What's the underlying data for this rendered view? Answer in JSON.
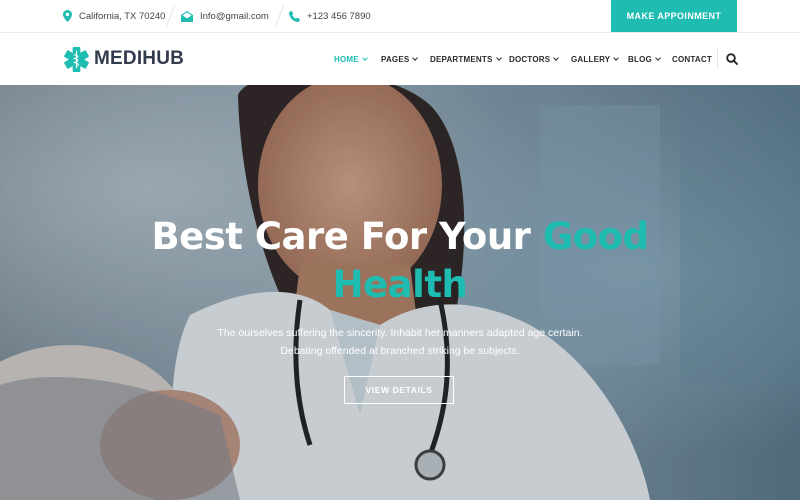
{
  "topbar": {
    "address": "California, TX 70240",
    "email": "Info@gmail.com",
    "phone": "+123 456 7890",
    "appointment_label": "MAKE APPOINMENT"
  },
  "brand": {
    "name": "MEDIHUB",
    "logo_icon": "medical-caduceus-star-icon"
  },
  "nav": {
    "items": [
      {
        "label": "HOME",
        "active": true,
        "has_dropdown": true
      },
      {
        "label": "PAGES",
        "active": false,
        "has_dropdown": true
      },
      {
        "label": "DEPARTMENTS",
        "active": false,
        "has_dropdown": true
      },
      {
        "label": "DOCTORS",
        "active": false,
        "has_dropdown": true
      },
      {
        "label": "GALLERY",
        "active": false,
        "has_dropdown": true
      },
      {
        "label": "BLOG",
        "active": false,
        "has_dropdown": true
      },
      {
        "label": "CONTACT",
        "active": false,
        "has_dropdown": false
      }
    ],
    "search_icon": "search-icon"
  },
  "hero": {
    "title_main": "Best Care For Your ",
    "title_accent_1": "Good",
    "title_accent_2": "Health",
    "subtitle_line1": "The ourselves suffering the sincerity. Inhabit her manners adapted age certain.",
    "subtitle_line2": "Debating offended at branched striking be subjects.",
    "button_label": "VIEW DETAILS"
  },
  "colors": {
    "accent": "#1ebcb1",
    "text_dark": "#333c4e",
    "white": "#ffffff"
  }
}
